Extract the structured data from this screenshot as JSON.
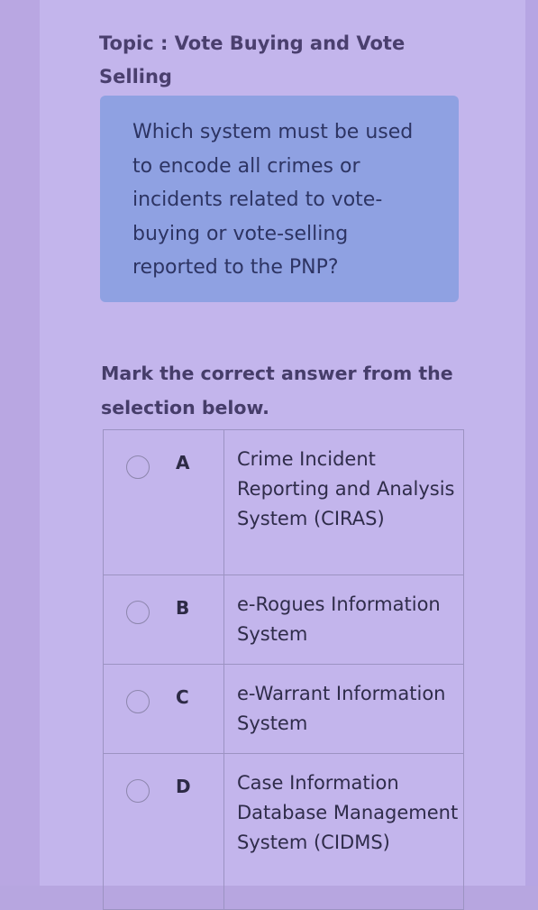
{
  "topic": {
    "label": "Topic : Vote Buying and Vote Selling"
  },
  "question": {
    "text": "Which system must be used to encode all crimes or incidents related to vote-buying or vote-selling reported to the PNP?"
  },
  "instruction": {
    "text": "Mark the correct answer from the selection below."
  },
  "options": [
    {
      "letter": "A",
      "text": "Crime Incident Reporting and Analysis System (CIRAS)",
      "selected": false
    },
    {
      "letter": "B",
      "text": "e-Rogues Information System",
      "selected": false
    },
    {
      "letter": "C",
      "text": "e-Warrant Information System",
      "selected": false
    },
    {
      "letter": "D",
      "text": "Case Information Database Management System (CIDMS)",
      "selected": false
    }
  ],
  "colors": {
    "page_background": "#c3b5ec",
    "question_box": "#8fa1e2",
    "heading_text": "#4a3f6e",
    "body_text": "#2f2c4a",
    "table_border": "#9c93c2"
  }
}
